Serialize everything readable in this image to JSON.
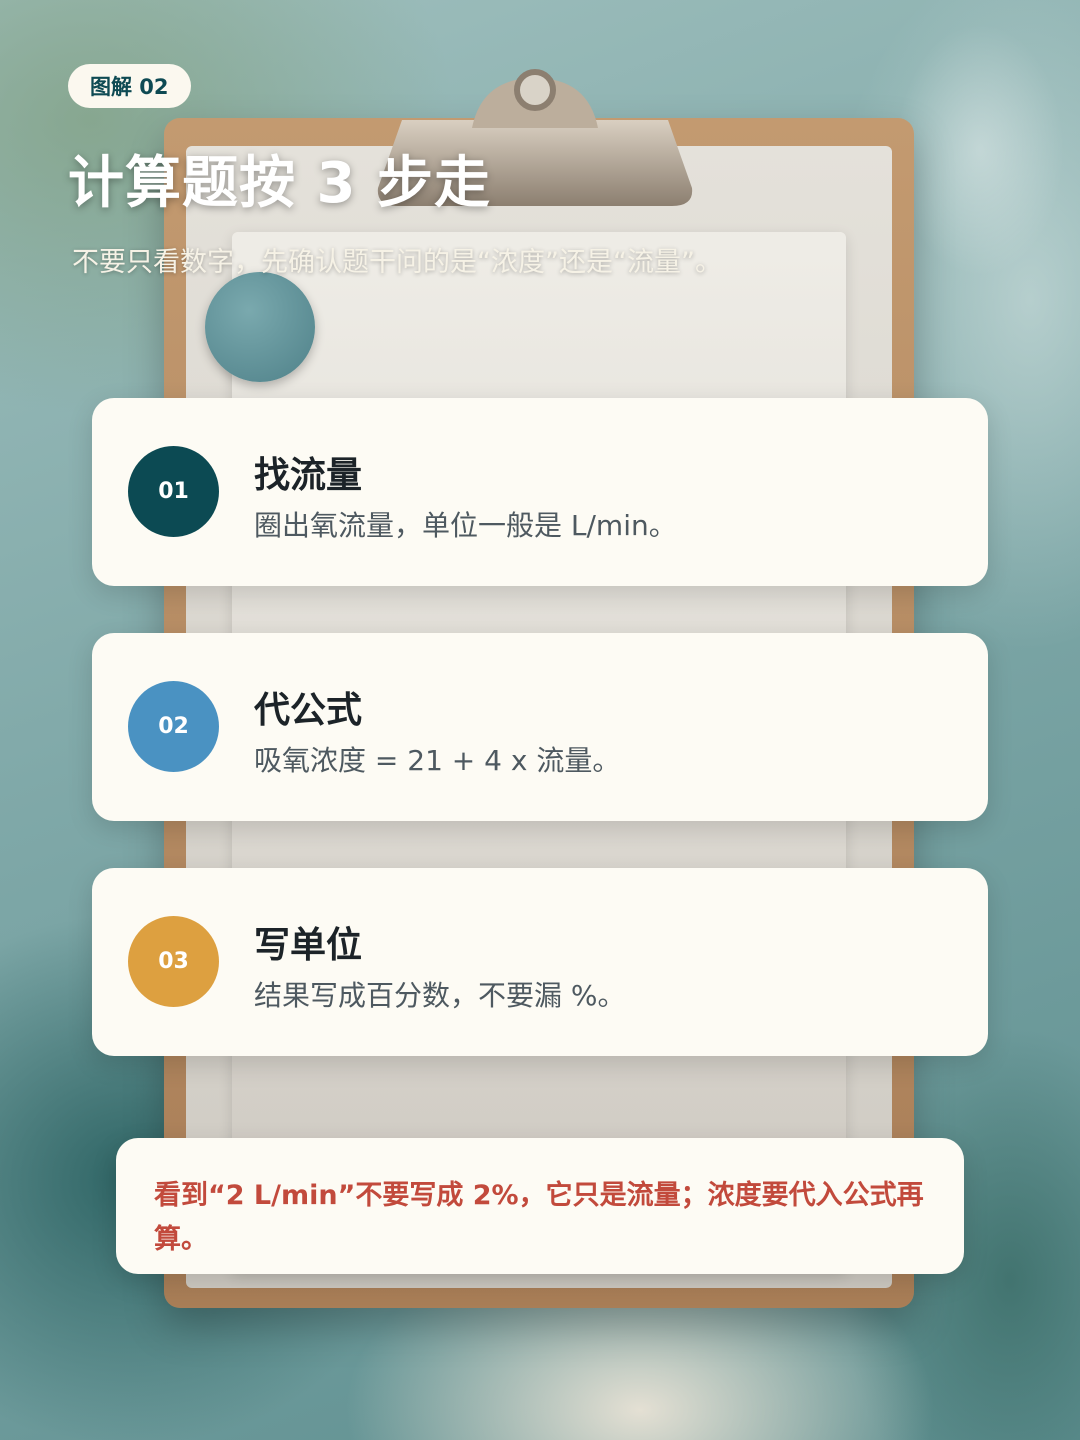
{
  "badge": "图解 02",
  "title": "计算题按 3 步走",
  "subtitle": "不要只看数字，先确认题干问的是“浓度”还是“流量”。",
  "steps": [
    {
      "num": "01",
      "title": "找流量",
      "desc": "圈出氧流量，单位一般是 L/min。",
      "color": "#0c4a53"
    },
    {
      "num": "02",
      "title": "代公式",
      "desc": "吸氧浓度 = 21 + 4 x 流量。",
      "color": "#4a92c2"
    },
    {
      "num": "03",
      "title": "写单位",
      "desc": "结果写成百分数，不要漏 %。",
      "color": "#dda040"
    }
  ],
  "note": "看到“2 L/min”不要写成 2%，它只是流量；浓度要代入公式再算。",
  "colors": {
    "note_text": "#c24a3c",
    "badge_text": "#0e4a53",
    "card_bg": "#fdfbf4"
  }
}
